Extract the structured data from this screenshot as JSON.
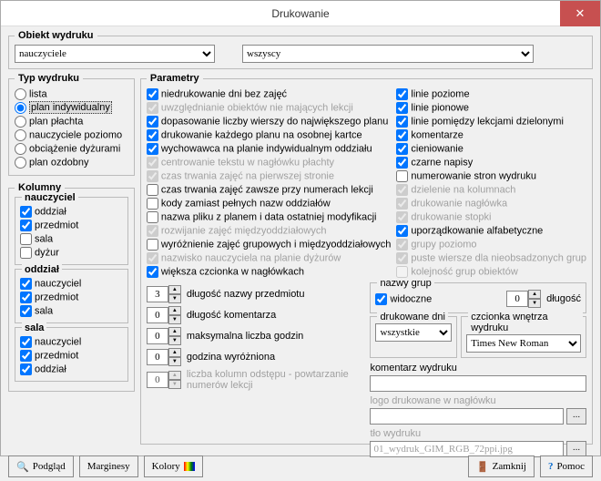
{
  "title": "Drukowanie",
  "obiekt": {
    "legend": "Obiekt wydruku",
    "sel1": "nauczyciele",
    "sel2": "wszyscy"
  },
  "typ": {
    "legend": "Typ wydruku",
    "items": [
      "lista",
      "plan indywidualny",
      "plan płachta",
      "nauczyciele poziomo",
      "obciążenie dyżurami",
      "plan ozdobny"
    ]
  },
  "kolumny": {
    "legend": "Kolumny",
    "g1": {
      "legend": "nauczyciel",
      "items": [
        "oddział",
        "przedmiot",
        "sala",
        "dyżur"
      ],
      "checked": [
        true,
        true,
        false,
        false
      ]
    },
    "g2": {
      "legend": "oddział",
      "items": [
        "nauczyciel",
        "przedmiot",
        "sala"
      ],
      "checked": [
        true,
        true,
        true
      ]
    },
    "g3": {
      "legend": "sala",
      "items": [
        "nauczyciel",
        "przedmiot",
        "oddział"
      ],
      "checked": [
        true,
        true,
        true
      ]
    }
  },
  "params": {
    "legend": "Parametry",
    "left": [
      {
        "t": "niedrukowanie dni bez zajęć",
        "c": true,
        "d": false
      },
      {
        "t": "uwzględnianie obiektów nie mających lekcji",
        "c": true,
        "d": true
      },
      {
        "t": "dopasowanie liczby wierszy do największego planu",
        "c": true,
        "d": false
      },
      {
        "t": "drukowanie każdego planu na osobnej kartce",
        "c": true,
        "d": false
      },
      {
        "t": "wychowawca na planie indywidualnym oddziału",
        "c": true,
        "d": false
      },
      {
        "t": "centrowanie tekstu w nagłówku płachty",
        "c": true,
        "d": true
      },
      {
        "t": "czas trwania zajęć na pierwszej stronie",
        "c": true,
        "d": true
      },
      {
        "t": "czas trwania zajęć zawsze przy numerach lekcji",
        "c": false,
        "d": false
      },
      {
        "t": "kody zamiast pełnych nazw oddziałów",
        "c": false,
        "d": false
      },
      {
        "t": "nazwa pliku z planem i data ostatniej modyfikacji",
        "c": false,
        "d": false
      },
      {
        "t": "rozwijanie zajęć międzyoddziałowych",
        "c": true,
        "d": true
      },
      {
        "t": "wyróżnienie zajęć grupowych i międzyoddziałowych",
        "c": false,
        "d": false
      },
      {
        "t": "nazwisko nauczyciela na planie dyżurów",
        "c": true,
        "d": true
      },
      {
        "t": "większa czcionka w nagłówkach",
        "c": true,
        "d": false
      }
    ],
    "right": [
      {
        "t": "linie poziome",
        "c": true,
        "d": false
      },
      {
        "t": "linie pionowe",
        "c": true,
        "d": false
      },
      {
        "t": "linie pomiędzy lekcjami dzielonymi",
        "c": true,
        "d": false
      },
      {
        "t": "komentarze",
        "c": true,
        "d": false
      },
      {
        "t": "cieniowanie",
        "c": true,
        "d": false
      },
      {
        "t": "czarne napisy",
        "c": true,
        "d": false
      },
      {
        "t": "numerowanie stron wydruku",
        "c": false,
        "d": false
      },
      {
        "t": "dzielenie na kolumnach",
        "c": true,
        "d": true
      },
      {
        "t": "drukowanie nagłówka",
        "c": true,
        "d": true
      },
      {
        "t": "drukowanie stopki",
        "c": true,
        "d": true
      },
      {
        "t": "uporządkowanie alfabetyczne",
        "c": true,
        "d": false
      },
      {
        "t": "grupy poziomo",
        "c": true,
        "d": true
      },
      {
        "t": "puste wiersze dla nieobsadzonych grup",
        "c": true,
        "d": true
      },
      {
        "t": "kolejność grup obiektów",
        "c": false,
        "d": true
      }
    ],
    "nums": [
      {
        "v": "3",
        "t": "długość nazwy przedmiotu",
        "d": false
      },
      {
        "v": "0",
        "t": "długość komentarza",
        "d": false
      },
      {
        "v": "0",
        "t": "maksymalna liczba godzin",
        "d": false
      },
      {
        "v": "0",
        "t": "godzina wyróżniona",
        "d": false
      },
      {
        "v": "0",
        "t": "liczba kolumn odstępu - powtarzanie numerów lekcji",
        "d": true
      }
    ],
    "nazwyGrup": {
      "legend": "nazwy grup",
      "widoczne": "widoczne",
      "dlugosc": "długość",
      "dlVal": "0"
    },
    "drukDni": {
      "legend": "drukowane dni",
      "val": "wszystkie"
    },
    "czcionka": {
      "legend": "czcionka wnętrza wydruku",
      "val": "Times New Roman"
    },
    "komentarz": {
      "legend": "komentarz wydruku",
      "val": ""
    },
    "logo": {
      "legend": "logo drukowane w nagłówku",
      "val": ""
    },
    "tlo": {
      "legend": "tło wydruku",
      "val": "01_wydruk_GIM_RGB_72ppi.jpg"
    }
  },
  "buttons": {
    "podglad": "Podgląd",
    "marginesy": "Marginesy",
    "kolory": "Kolory",
    "zamknij": "Zamknij",
    "pomoc": "Pomoc"
  }
}
